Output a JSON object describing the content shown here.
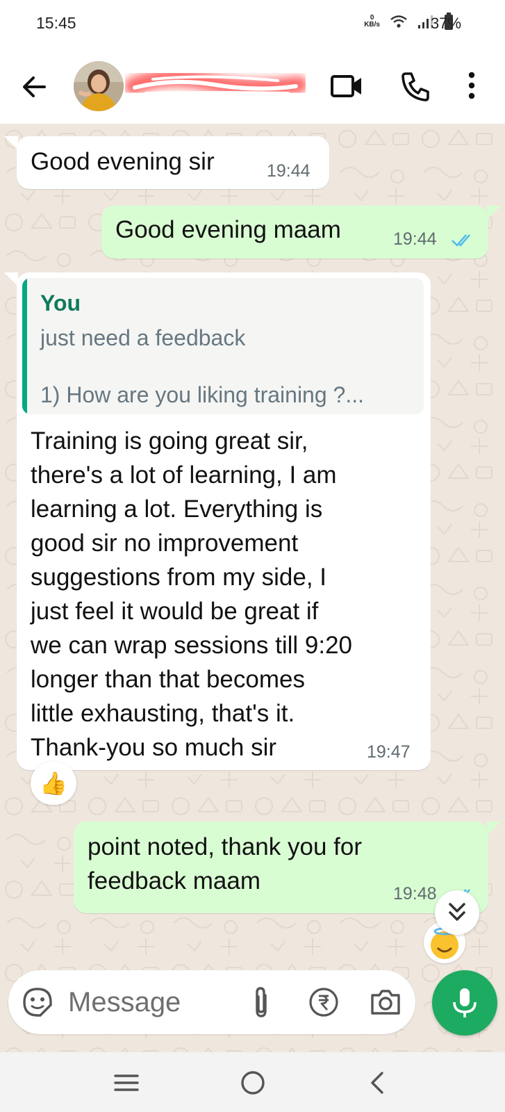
{
  "status_bar": {
    "time": "15:45",
    "net_speed_value": "0",
    "net_speed_unit": "KB/s",
    "battery": "37%"
  },
  "header": {
    "contact_name": "",
    "icons": [
      "back-arrow-icon",
      "video-call-icon",
      "phone-icon",
      "more-vert-icon"
    ]
  },
  "messages": [
    {
      "direction": "incoming",
      "text": "Good evening sir",
      "time": "19:44"
    },
    {
      "direction": "outgoing",
      "text": "Good evening maam",
      "time": "19:44",
      "status": "read"
    },
    {
      "direction": "incoming",
      "quote": {
        "author": "You",
        "line1": "just need a feedback",
        "line2": "1) How are you liking training ?..."
      },
      "lines": [
        "Training is going great sir,",
        "there's a lot of learning, I am",
        "learning a lot. Everything is",
        "good sir no improvement",
        "suggestions from my side,  I",
        "just feel it would be great if",
        "we can wrap sessions till 9:20",
        "longer than that becomes",
        "little exhausting, that's it.",
        "Thank-you so much sir"
      ],
      "time": "19:47",
      "reaction": "👍"
    },
    {
      "direction": "outgoing",
      "lines": [
        "point noted, thank you for",
        "feedback maam"
      ],
      "time": "19:48",
      "status": "read"
    }
  ],
  "composer": {
    "placeholder": "Message",
    "icons": [
      "emoji-icon",
      "attach-icon",
      "rupee-payment-icon",
      "camera-icon",
      "mic-icon"
    ]
  },
  "colors": {
    "outgoing_bubble": "#d9fdd3",
    "incoming_bubble": "#ffffff",
    "wallpaper": "#efe7de",
    "accent": "#1daa61",
    "read_ticks": "#53bdeb",
    "quote_bar": "#06a884"
  }
}
